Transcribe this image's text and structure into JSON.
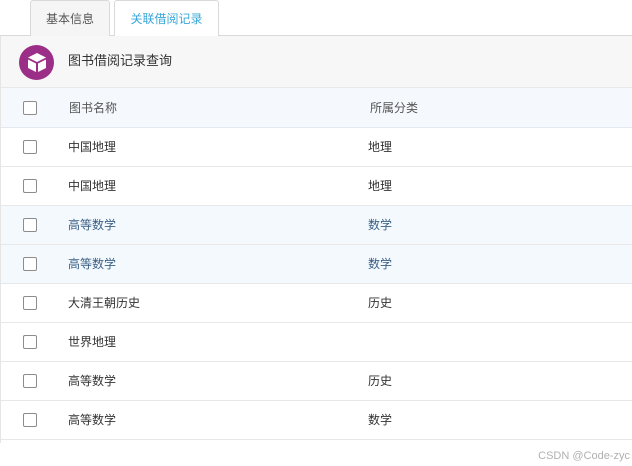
{
  "tabs": [
    {
      "label": "基本信息",
      "active": false
    },
    {
      "label": "关联借阅记录",
      "active": true
    }
  ],
  "panel": {
    "title": "图书借阅记录查询",
    "icon": "box-icon"
  },
  "table": {
    "columns": [
      "图书名称",
      "所属分类"
    ],
    "rows": [
      {
        "name": "中国地理",
        "category": "地理",
        "highlighted": false
      },
      {
        "name": "中国地理",
        "category": "地理",
        "highlighted": false
      },
      {
        "name": "高等数学",
        "category": "数学",
        "highlighted": true
      },
      {
        "name": "高等数学",
        "category": "数学",
        "highlighted": true
      },
      {
        "name": "大清王朝历史",
        "category": "历史",
        "highlighted": false
      },
      {
        "name": "世界地理",
        "category": "",
        "highlighted": false
      },
      {
        "name": "高等数学",
        "category": "历史",
        "highlighted": false
      },
      {
        "name": "高等数学",
        "category": "数学",
        "highlighted": false
      }
    ]
  },
  "watermark": "CSDN @Code-zyc",
  "colors": {
    "accent": "#38a8d8",
    "logo": "#9b2f88",
    "row_highlight": "#f4f9fd"
  }
}
